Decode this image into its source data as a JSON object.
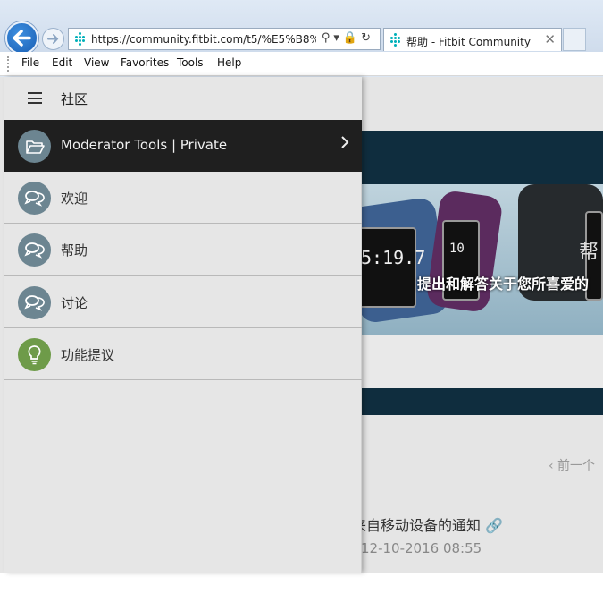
{
  "browser": {
    "url": "https://community.fitbit.com/t5/%E5%B8%AE%",
    "tab_title": "帮助 - Fitbit Community",
    "tab_close": "✕",
    "addr_icons": "⚲▾🔒↻"
  },
  "menubar": {
    "items": [
      "File",
      "Edit",
      "View",
      "Favorites",
      "Tools",
      "Help"
    ]
  },
  "drawer": {
    "title": "社区",
    "items": [
      {
        "label": "Moderator Tools | Private",
        "icon": "folder-icon"
      },
      {
        "label": "欢迎",
        "icon": "chat-icon"
      },
      {
        "label": "帮助",
        "icon": "chat-icon"
      },
      {
        "label": "讨论",
        "icon": "chat-icon"
      },
      {
        "label": "功能提议",
        "icon": "lightbulb-icon"
      }
    ]
  },
  "hero": {
    "glyph": "帮",
    "text": "提出和解答关于您所喜爱的",
    "watch1": "5:19.7",
    "watch2": "10"
  },
  "page": {
    "prev_label": "‹ 前一个",
    "post_title": "来自移动设备的通知 🔗",
    "post_date": "12-10-2016 08:55"
  },
  "colors": {
    "drawer_active_bg": "#1f1f1f",
    "icon_gray": "#6c8591",
    "icon_green": "#6e9b49",
    "back_button": "#1a5fb4"
  }
}
